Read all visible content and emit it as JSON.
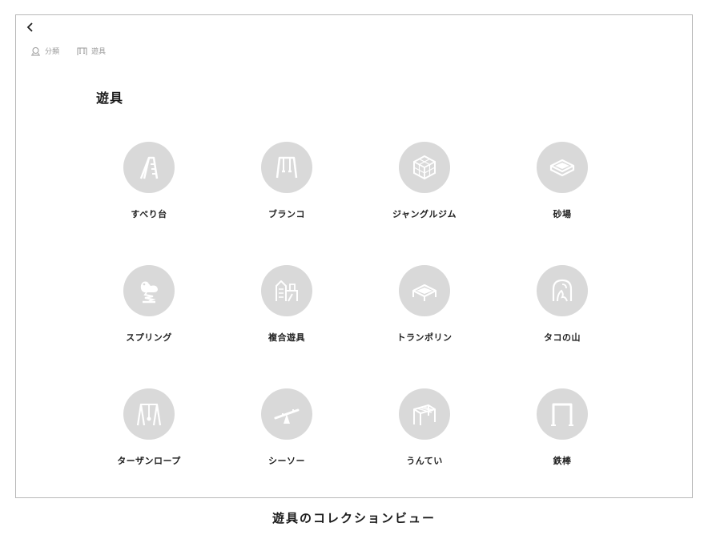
{
  "breadcrumb": {
    "items": [
      {
        "label": "分類",
        "icon": "category-icon"
      },
      {
        "label": "遊具",
        "icon": "playground-icon"
      }
    ]
  },
  "main": {
    "title": "遊具",
    "items": [
      {
        "label": "すべり台",
        "icon": "slide-icon"
      },
      {
        "label": "ブランコ",
        "icon": "swing-icon"
      },
      {
        "label": "ジャングルジム",
        "icon": "jungle-gym-icon"
      },
      {
        "label": "砂場",
        "icon": "sandbox-icon"
      },
      {
        "label": "スプリング",
        "icon": "spring-rider-icon"
      },
      {
        "label": "複合遊具",
        "icon": "combination-play-icon"
      },
      {
        "label": "トランポリン",
        "icon": "trampoline-icon"
      },
      {
        "label": "タコの山",
        "icon": "octopus-mountain-icon"
      },
      {
        "label": "ターザンロープ",
        "icon": "tarzan-rope-icon"
      },
      {
        "label": "シーソー",
        "icon": "seesaw-icon"
      },
      {
        "label": "うんてい",
        "icon": "monkey-bars-icon"
      },
      {
        "label": "鉄棒",
        "icon": "horizontal-bar-icon"
      }
    ]
  },
  "caption": "遊具のコレクションビュー",
  "colors": {
    "icon_circle": "#d9d9d9",
    "icon_stroke": "#ffffff",
    "border": "#b8b8b8"
  }
}
